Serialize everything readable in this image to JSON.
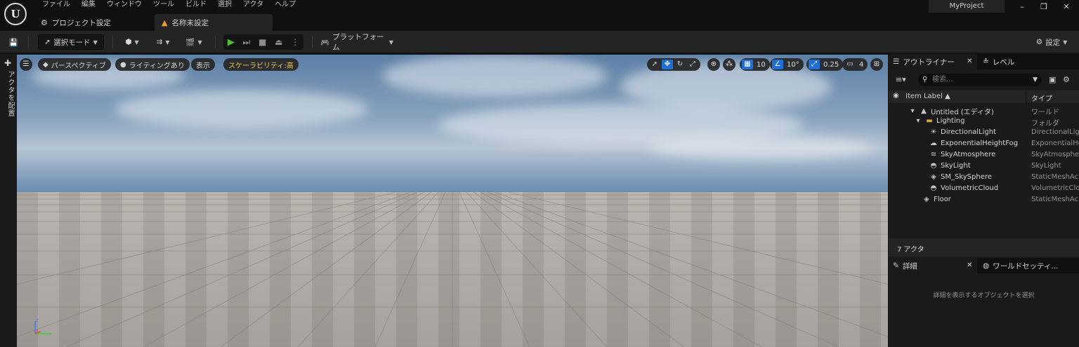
{
  "menu": [
    "ファイル",
    "編集",
    "ウィンドウ",
    "ツール",
    "ビルド",
    "選択",
    "アクタ",
    "ヘルプ"
  ],
  "tabs": {
    "project_settings": "プロジェクト設定",
    "untitled": "名称未設定"
  },
  "project_name": "MyProject",
  "toolbar": {
    "select_mode": "選択モード",
    "platform": "プラットフォーム",
    "settings": "設定"
  },
  "left": {
    "place_actor": "アクタを配置"
  },
  "viewport": {
    "perspective": "パースペクティブ",
    "lighting": "ライティングあり",
    "show": "表示",
    "scalability": "スケーラビリティ:高",
    "grid_snap": "10",
    "rot_snap": "10°",
    "scale_snap": "0.25",
    "camera_speed": "4"
  },
  "outliner": {
    "tab": "アウトライナー",
    "level_tab": "レベル",
    "search_placeholder": "検索...",
    "col_label": "Item Label ▲",
    "col_type": "タイプ",
    "rows": [
      {
        "label": "Untitled (エディタ)",
        "type": "ワールド"
      },
      {
        "label": "Lighting",
        "type": "フォルダ"
      },
      {
        "label": "DirectionalLight",
        "type": "DirectionalLight"
      },
      {
        "label": "ExponentialHeightFog",
        "type": "ExponentialHe"
      },
      {
        "label": "SkyAtmosphere",
        "type": "SkyAtmosphe"
      },
      {
        "label": "SkyLight",
        "type": "SkyLight"
      },
      {
        "label": "SM_SkySphere",
        "type": "StaticMeshAc"
      },
      {
        "label": "VolumetricCloud",
        "type": "VolumetricClo"
      },
      {
        "label": "Floor",
        "type": "StaticMeshAc"
      }
    ],
    "count": "7 アクタ"
  },
  "details": {
    "tab": "詳細",
    "world_tab": "ワールドセッティ...",
    "hint": "詳細を表示するオブジェクトを選択"
  },
  "colors": {
    "accent": "#1f6fd6",
    "play": "#4fbf3a",
    "scalability": "#f2c94c"
  }
}
